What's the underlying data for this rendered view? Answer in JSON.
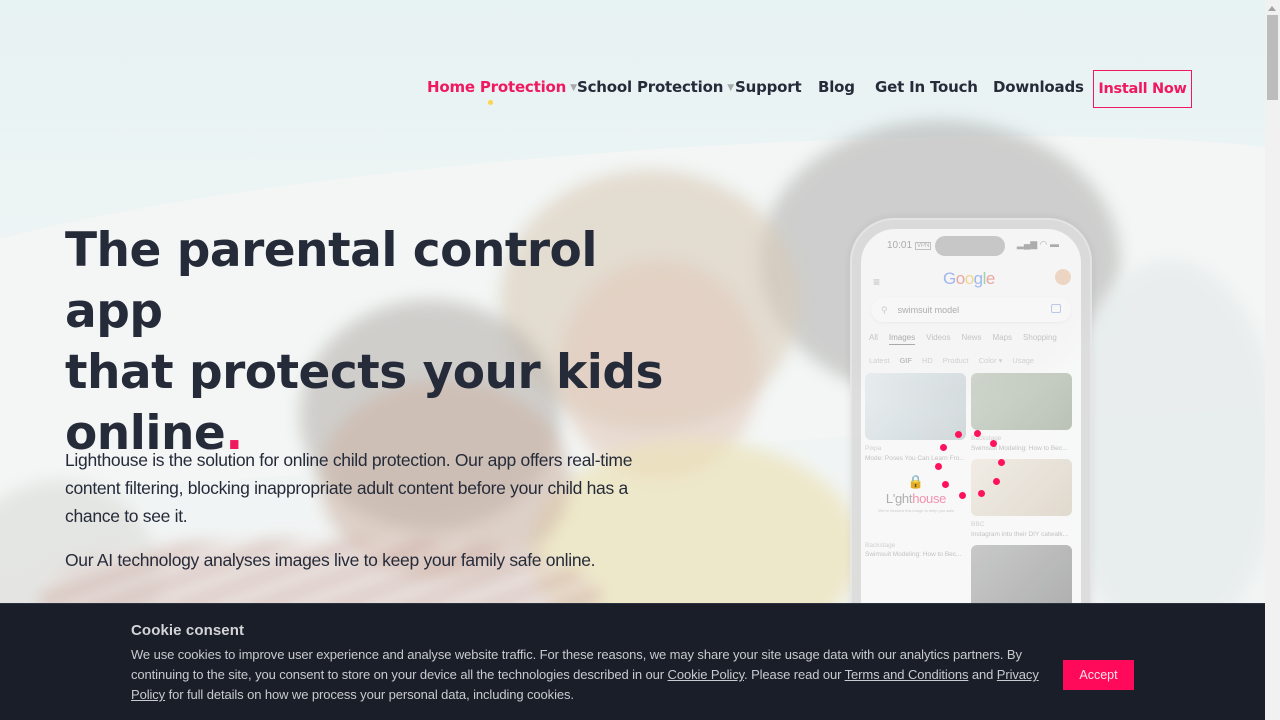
{
  "nav": {
    "items": [
      {
        "label": "Home Protection",
        "active": true,
        "has_dropdown": true
      },
      {
        "label": "School Protection",
        "active": false,
        "has_dropdown": true
      },
      {
        "label": "Support",
        "active": false,
        "has_dropdown": false
      },
      {
        "label": "Blog",
        "active": false,
        "has_dropdown": false
      },
      {
        "label": "Get In Touch",
        "active": false,
        "has_dropdown": false
      },
      {
        "label": "Downloads",
        "active": false,
        "has_dropdown": false
      }
    ],
    "caret_glyph": "▼",
    "install_label": "Install Now"
  },
  "hero": {
    "title_line1": "The parental control app",
    "title_line2": "that protects your kids",
    "title_line3": "online",
    "title_dot": ".",
    "paragraph1": "Lighthouse is the solution for online child protection. Our app offers real-time content filtering, blocking inappropriate adult content before your child has a chance to see it.",
    "paragraph2": "Our AI technology analyses images live to keep your family safe online."
  },
  "phone": {
    "time": "10:01",
    "vpn": "VPN",
    "status_icons": "▂▄▆ ◠ ▬",
    "menu_icon": "≡",
    "google_letters": [
      "G",
      "o",
      "o",
      "g",
      "l",
      "e"
    ],
    "search_query": "swimsuit model",
    "search_icon": "⚲",
    "tabs": [
      "All",
      "Images",
      "Videos",
      "News",
      "Maps",
      "Shopping"
    ],
    "selected_tab": "Images",
    "chips": [
      "Latest",
      "GIF",
      "HD",
      "Product",
      "Color ▾",
      "Usage"
    ],
    "results": [
      {
        "source": "Pixpa",
        "caption": "Mode: Poses You Can Learn Fro..."
      },
      {
        "source": "Backstage",
        "caption": "Swimsuit Modeling: How to Bec..."
      },
      {
        "source": "BBC",
        "caption": "Instagram into their DIY catwalk..."
      },
      {
        "source": "Backstage",
        "caption": "Swimsuit Modeling: How to Bec..."
      }
    ],
    "blocked_logo_prefix": "L'ght",
    "blocked_logo_suffix": "house",
    "blocked_sub": "We've blocked this image to keep you safe",
    "lock_icon": "🔒"
  },
  "cookie": {
    "title": "Cookie consent",
    "text_part1": "We use cookies to improve user experience and analyse website traffic. For these reasons, we may share your site usage data with our analytics partners. By continuing to the site, you consent to store on your device all the technologies described in our ",
    "cookie_policy_link": "Cookie Policy",
    "text_part2": ". Please read our ",
    "terms_link": "Terms and Conditions",
    "text_part3": " and ",
    "privacy_link": "Privacy Policy",
    "text_part4": " for full details on how we process your personal data, including cookies.",
    "accept_label": "Accept"
  },
  "colors": {
    "brand_pink": "#f0185f",
    "active_dot": "#ffd34e",
    "text_dark": "#262b3a",
    "cookie_bg": "#1a1e28",
    "accept_bg": "#ff0a5a"
  }
}
